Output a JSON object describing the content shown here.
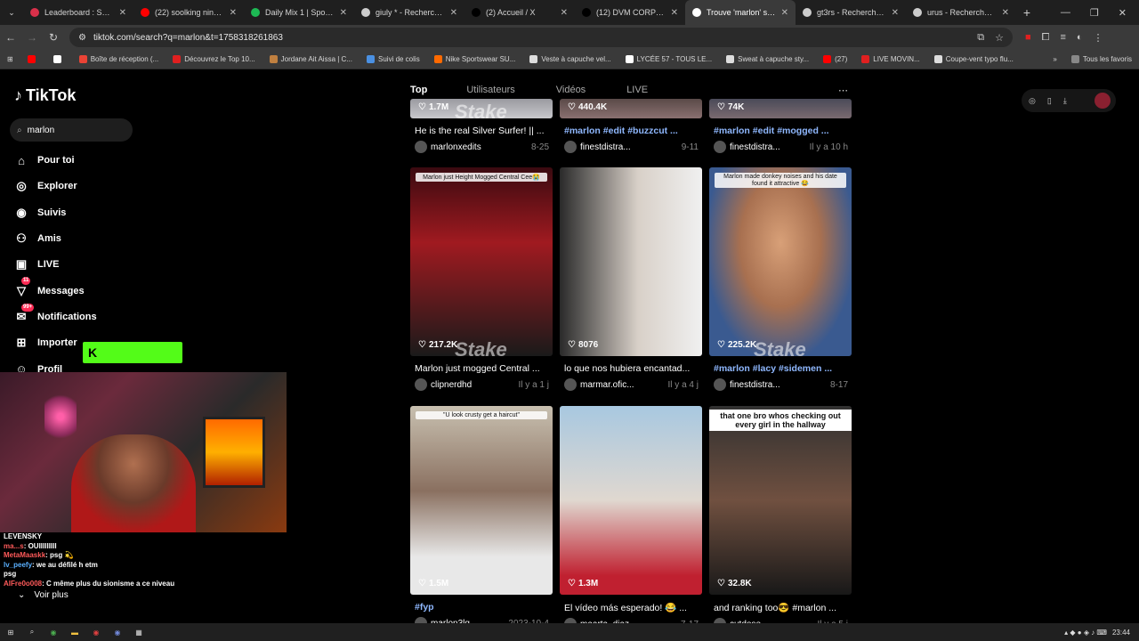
{
  "browser": {
    "tabs": [
      {
        "label": "Leaderboard : Solary",
        "color": "#d9304a"
      },
      {
        "label": "(22) soolking ninho -",
        "color": "#ff0000"
      },
      {
        "label": "Daily Mix 1 | Spotify P",
        "color": "#1db954"
      },
      {
        "label": "giuly * - Recherche G",
        "color": "#cccccc"
      },
      {
        "label": "(2) Accueil / X",
        "color": "#000000"
      },
      {
        "label": "(12) DVM CORP sur X",
        "color": "#000000"
      },
      {
        "label": "Trouve 'marlon' sur T",
        "color": "#ffffff",
        "active": true
      },
      {
        "label": "gt3rs - Recherche Go",
        "color": "#cccccc"
      },
      {
        "label": "urus - Recherche Goo",
        "color": "#cccccc"
      }
    ],
    "url": "tiktok.com/search?q=marlon&t=1758318261863",
    "bookmarks": [
      {
        "label": "",
        "color": "#ff0000"
      },
      {
        "label": "",
        "color": "#ffffff"
      },
      {
        "label": "Boîte de réception (...",
        "color": "#ea4335"
      },
      {
        "label": "Découvrez le Top 10...",
        "color": "#e02020"
      },
      {
        "label": "Jordane Ait Aissa | C...",
        "color": "#c08040"
      },
      {
        "label": "Suivi de colis",
        "color": "#4a90e2"
      },
      {
        "label": "Nike Sportswear SU...",
        "color": "#ff6a00"
      },
      {
        "label": "Veste à capuche vel...",
        "color": "#dddddd"
      },
      {
        "label": "LYCÉE 57 - TOUS LE...",
        "color": "#ffffff"
      },
      {
        "label": "Sweat à capuche sty...",
        "color": "#dddddd"
      },
      {
        "label": "(27)",
        "color": "#ff0000"
      },
      {
        "label": "LIVE MOVIN...",
        "color": "#e02020"
      },
      {
        "label": "Coupe-vent typo flu...",
        "color": "#dddddd"
      }
    ],
    "all_bookmarks": "Tous les favoris"
  },
  "tiktok": {
    "logo": "TikTok",
    "search_value": "marlon",
    "nav": [
      {
        "label": "Pour toi",
        "icon": "home-icon",
        "glyph": "⌂"
      },
      {
        "label": "Explorer",
        "icon": "compass-icon",
        "glyph": "◎"
      },
      {
        "label": "Suivis",
        "icon": "following-avatar-icon",
        "glyph": "◉"
      },
      {
        "label": "Amis",
        "icon": "friends-icon",
        "glyph": "⚇"
      },
      {
        "label": "LIVE",
        "icon": "live-icon",
        "glyph": "▣"
      },
      {
        "label": "Messages",
        "icon": "messages-icon",
        "glyph": "▽",
        "badge": "11"
      },
      {
        "label": "Notifications",
        "icon": "notifications-icon",
        "glyph": "✉",
        "badge": "99+"
      },
      {
        "label": "Importer",
        "icon": "upload-icon",
        "glyph": "⊞"
      },
      {
        "label": "Profil",
        "icon": "profile-icon",
        "glyph": "☺"
      }
    ],
    "filters": [
      "Top",
      "Utilisateurs",
      "Vidéos",
      "LIVE"
    ],
    "videos": [
      {
        "likes": "1.7M",
        "desc": "He is the real Silver Surfer! || ...",
        "user": "marlonxedits",
        "date": "8-25",
        "bg": "linear-gradient(#9a9aa0,#c8c8cc)",
        "stake": true
      },
      {
        "likes": "440.4K",
        "desc": "#marlon #edit #buzzcut ...",
        "tags": true,
        "user": "finestdistra...",
        "date": "9-11",
        "bg": "linear-gradient(#5a4a48,#8a7070)"
      },
      {
        "likes": "74K",
        "desc": "#marlon #edit #mogged ...",
        "tags": true,
        "user": "finestdistra...",
        "date": "Il y a 10 h",
        "bg": "linear-gradient(#4a4a58,#7a6a70)"
      },
      {
        "likes": "217.2K",
        "desc": "Marlon just mogged Central ...",
        "user": "clipnerdhd",
        "date": "Il y a 1 j",
        "caption": "Marlon just Height Mogged Central Cee😭",
        "bg": "linear-gradient(#3a0a10 0%,#a01a20 40%,#1a1a1a 100%)",
        "stake": true
      },
      {
        "likes": "8076",
        "desc": "lo que nos hubiera encantad...",
        "user": "marmar.ofic...",
        "date": "Il y a 4 j",
        "bg": "linear-gradient(90deg,#2a2a2a 0%,#d8d0c8 55%,#f0f0f0 100%)"
      },
      {
        "likes": "225.2K",
        "desc": "#marlon #lacy #sidemen ...",
        "tags": true,
        "user": "finestdistra...",
        "date": "8-17",
        "caption": "Marlon made donkey noises and his date found it attractive 😂",
        "bg": "radial-gradient(ellipse at 50% 40%,#d8a078 0%,#a87050 40%,#3a5a90 75%)",
        "stake": true
      },
      {
        "likes": "1.5M",
        "desc": "#fyp",
        "tags": true,
        "user": "marlon3lg",
        "date": "2023-10-4",
        "caption": "\"U look crusty get a haircut\"",
        "bg": "linear-gradient(#c8c0b0 0%,#8a7060 45%,#e8e8e8 80%)"
      },
      {
        "likes": "1.3M",
        "desc": "El vídeo más esperado! 😂 ...",
        "user": "maarta_diaz",
        "date": "7-17",
        "bg": "linear-gradient(#a8c8e0 0%,#e0d8d0 50%,#c02030 90%)"
      },
      {
        "likes": "32.8K",
        "desc": "and ranking too😎 #marlon ...",
        "user": "cutdose",
        "date": "Il y a 5 j",
        "caption": "that one bro whos checking out every girl in the hallway",
        "bg": "linear-gradient(#303030 0%,#705040 50%,#181818 100%)"
      }
    ]
  },
  "stream": {
    "chat": [
      {
        "user": "",
        "text": "LEVENSKY"
      },
      {
        "user": "ma...s",
        "text": ": OUIIIIIIIII"
      },
      {
        "user": "MetaMaaskk",
        "text": ": psg 💫"
      },
      {
        "user": "lv_peefy",
        "text": ": we au défilé h etm",
        "alt": true
      },
      {
        "user": "",
        "text": "psg"
      },
      {
        "user": "AlFre0o008",
        "text": ": C même plus du sionisme a ce niveau"
      }
    ],
    "voir_plus": "Voir plus"
  },
  "taskbar": {
    "time": "23:44"
  }
}
